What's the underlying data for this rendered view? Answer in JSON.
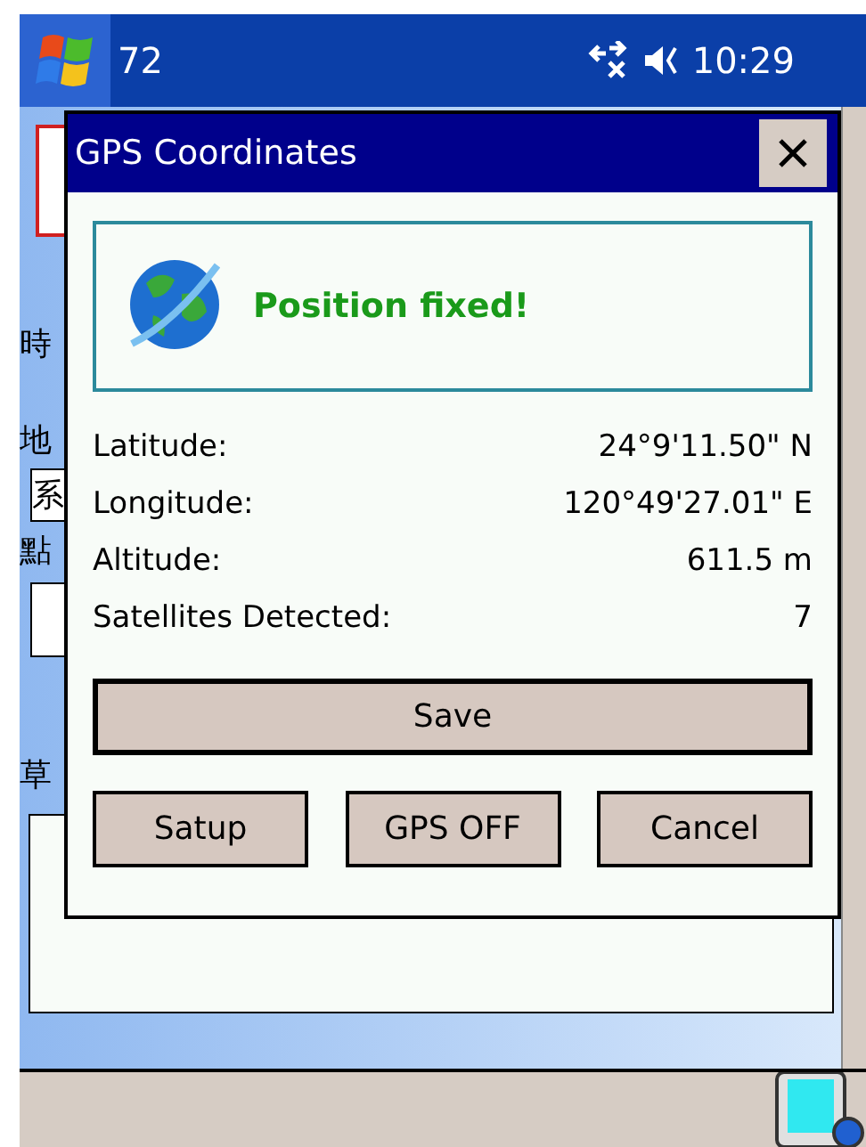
{
  "taskbar": {
    "title": "72",
    "time": "10:29"
  },
  "background_form": {
    "labels": [
      "時",
      "地",
      "點",
      "草"
    ],
    "field_value": "系"
  },
  "dialog": {
    "title": "GPS Coordinates",
    "status": "Position fixed!",
    "fields": [
      {
        "label": "Latitude:",
        "value": "24°9'11.50\" N"
      },
      {
        "label": "Longitude:",
        "value": "120°49'27.01\" E"
      },
      {
        "label": "Altitude:",
        "value": "611.5 m"
      },
      {
        "label": "Satellites Detected:",
        "value": "7"
      }
    ],
    "primary_button": "Save",
    "buttons": [
      "Satup",
      "GPS OFF",
      "Cancel"
    ]
  }
}
